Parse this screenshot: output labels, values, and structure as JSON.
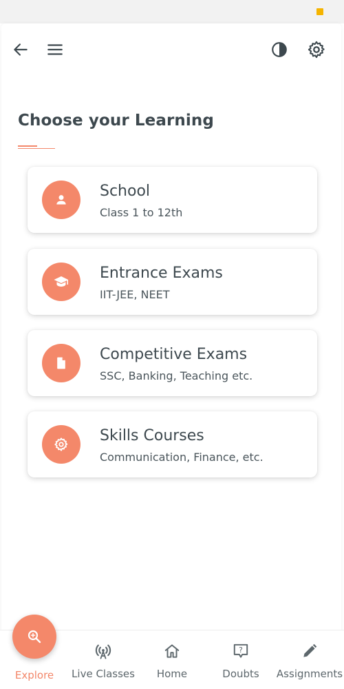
{
  "status_bar": {
    "left_text": "",
    "center_text": "",
    "right_text": ""
  },
  "header": {
    "back_icon": "arrow-left-icon",
    "menu_icon": "hamburger-menu-icon",
    "contrast_icon": "contrast-icon",
    "settings_icon": "gear-icon"
  },
  "main": {
    "heading": "Choose your Learning",
    "accent_color": "#f3876a",
    "categories": [
      {
        "title": "School",
        "subtitle": "Class 1 to 12th",
        "icon": "person-icon"
      },
      {
        "title": "Entrance Exams",
        "subtitle": "IIT-JEE, NEET",
        "icon": "graduation-cap-icon"
      },
      {
        "title": "Competitive Exams",
        "subtitle": "SSC, Banking, Teaching etc.",
        "icon": "document-icon"
      },
      {
        "title": "Skills Courses",
        "subtitle": "Communication, Finance, etc.",
        "icon": "gear-icon"
      }
    ]
  },
  "bottom_nav": {
    "items": [
      {
        "label": "Explore",
        "icon": "search-icon",
        "active": true
      },
      {
        "label": "Live Classes",
        "icon": "broadcast-icon"
      },
      {
        "label": "Home",
        "icon": "home-icon"
      },
      {
        "label": "Doubts",
        "icon": "question-bubble-icon"
      },
      {
        "label": "Assignments",
        "icon": "pencil-icon"
      }
    ]
  }
}
